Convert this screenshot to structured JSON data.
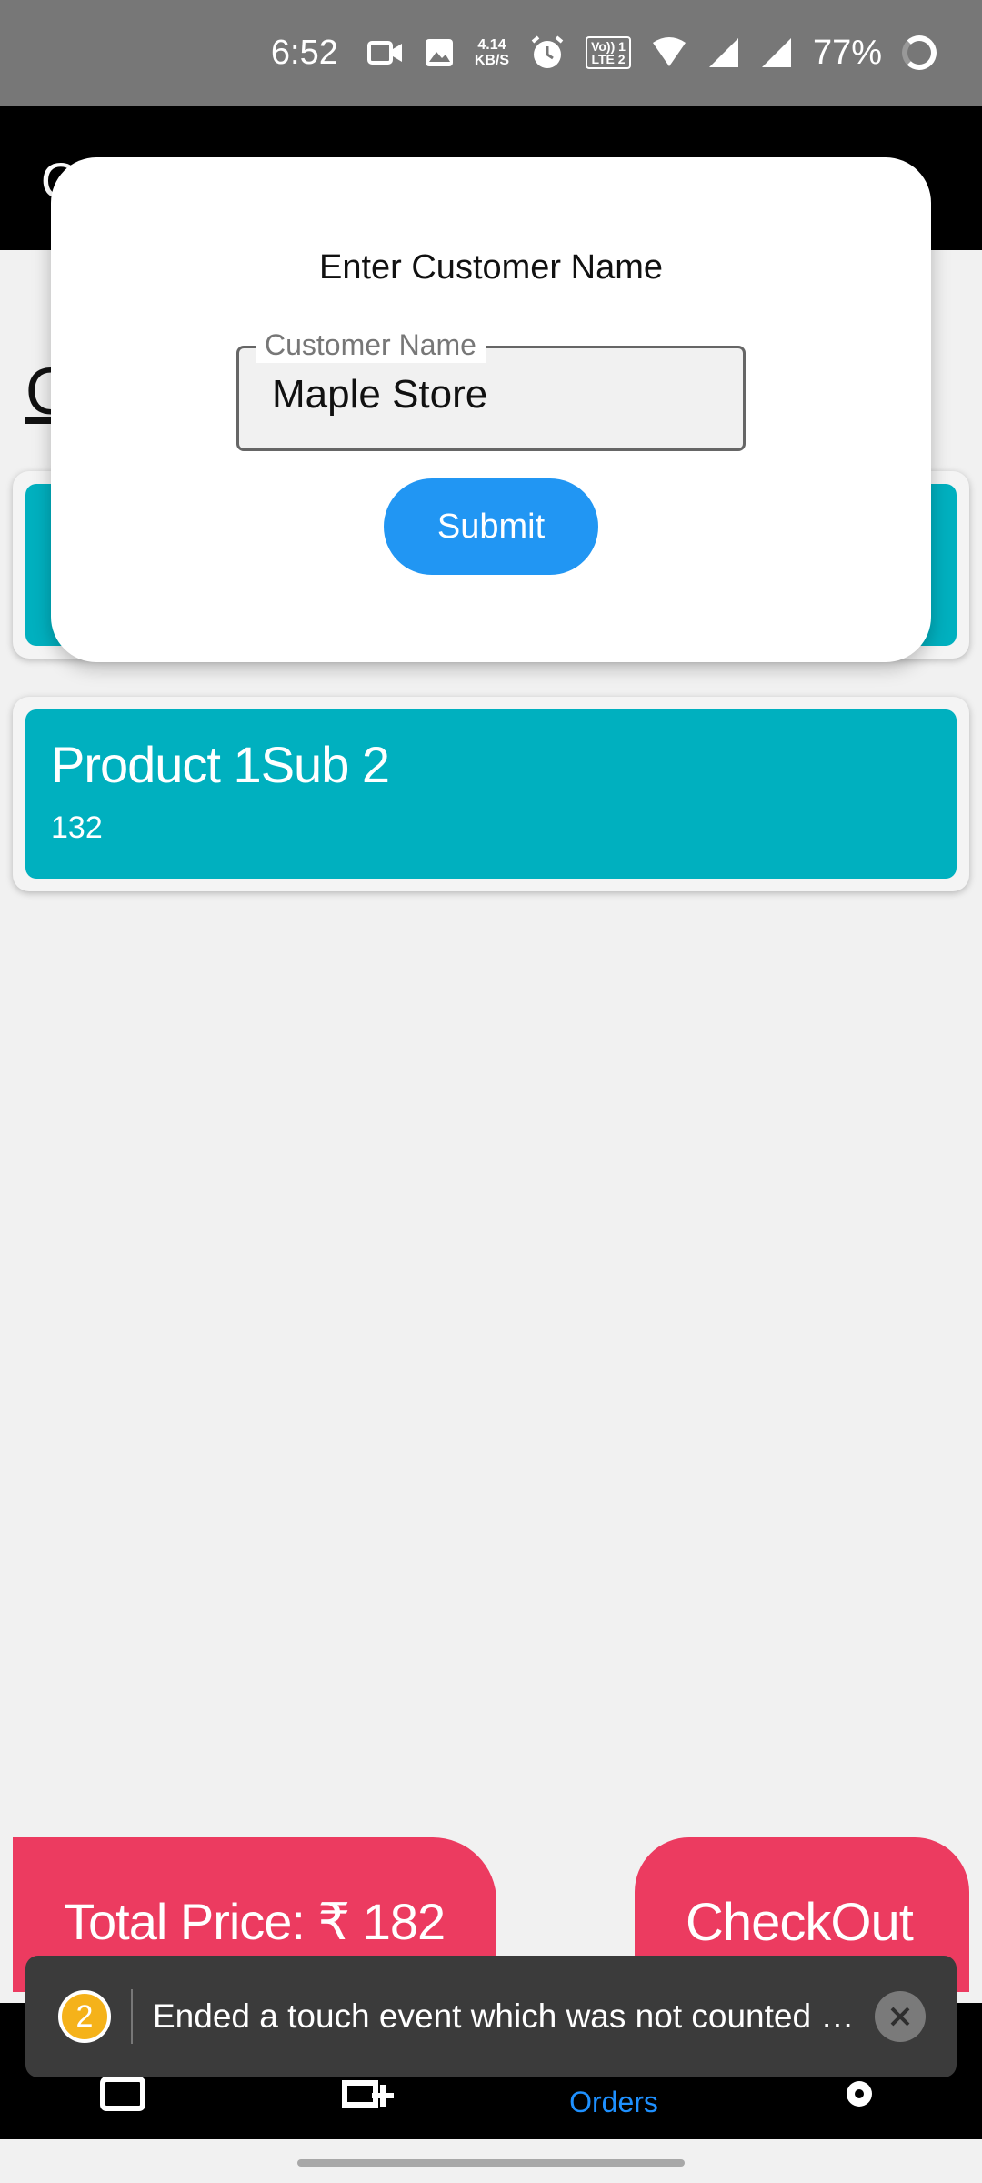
{
  "status_bar": {
    "time": "6:52",
    "net_speed_value": "4.14",
    "net_speed_unit": "KB/S",
    "lte_label_top": "Vo)) 1",
    "lte_label_bottom": "LTE 2",
    "battery": "77%",
    "icons": [
      "video-icon",
      "image-icon",
      "alarm-icon",
      "wifi-icon",
      "signal-icon",
      "signal-icon",
      "battery-icon"
    ]
  },
  "app_bar": {
    "title": "O"
  },
  "page": {
    "heading": "O"
  },
  "products": [
    {
      "name": "",
      "price": ""
    },
    {
      "name": "Product 1Sub 2",
      "price": "132"
    }
  ],
  "footer": {
    "total_price": "Total Price: ₹ 182",
    "checkout_label": "CheckOut"
  },
  "bottom_nav": {
    "items": [
      {
        "label": "",
        "icon": "add-box-icon",
        "active": false
      },
      {
        "label": "",
        "icon": "add-product-icon",
        "active": false
      },
      {
        "label": "Orders",
        "icon": "orders-icon",
        "active": true
      },
      {
        "label": "",
        "icon": "settings-icon",
        "active": false
      }
    ]
  },
  "dialog": {
    "title": "Enter Customer Name",
    "field_label": "Customer Name",
    "field_value": "Maple Store",
    "submit_label": "Submit"
  },
  "toast": {
    "badge": "2",
    "message": "Ended a touch event which was not counted in `trackedTouchCount`"
  },
  "colors": {
    "accent_teal": "#00b0bf",
    "accent_pink": "#ec3b60",
    "primary_blue": "#2196f3",
    "active_nav": "#1e90ff"
  }
}
